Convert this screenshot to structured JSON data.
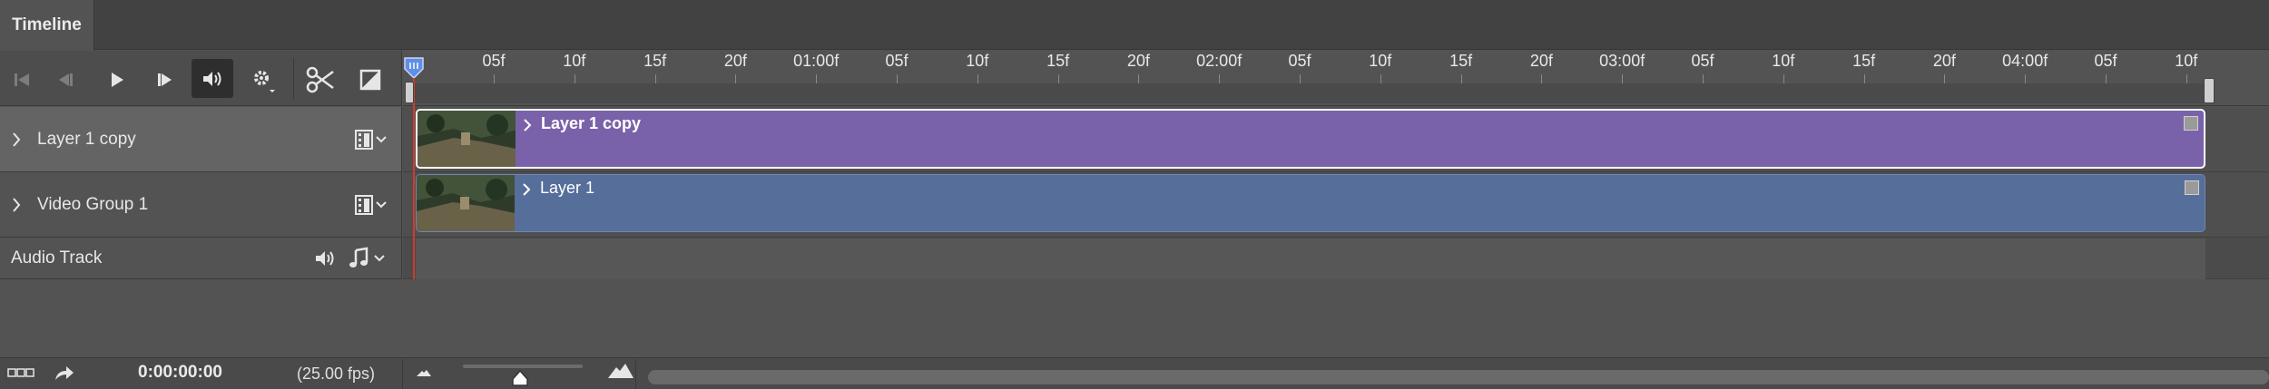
{
  "panel": {
    "tab_label": "Timeline"
  },
  "controls": {
    "icons": [
      "skip-to-start-icon",
      "previous-frame-icon",
      "play-icon",
      "next-frame-icon",
      "audio-icon",
      "settings-icon",
      "split-icon",
      "transition-icon"
    ]
  },
  "ruler": {
    "ticks": [
      "05f",
      "10f",
      "15f",
      "20f",
      "01:00f",
      "05f",
      "10f",
      "15f",
      "20f",
      "02:00f",
      "05f",
      "10f",
      "15f",
      "20f",
      "03:00f",
      "05f",
      "10f",
      "15f",
      "20f",
      "04:00f",
      "05f",
      "10f"
    ]
  },
  "tracks": [
    {
      "label": "Layer 1 copy",
      "clip_label": "Layer 1 copy",
      "clip_color": "#7a62aa",
      "selected": true
    },
    {
      "label": "Video Group 1",
      "clip_label": "Layer 1",
      "clip_color": "#566e9a",
      "selected": false
    }
  ],
  "audio_track": {
    "label": "Audio Track"
  },
  "status": {
    "timecode": "0:00:00:00",
    "fps": "(25.00 fps)"
  },
  "colors": {
    "playhead": "#d33a2c",
    "panel_bg": "#535353"
  }
}
